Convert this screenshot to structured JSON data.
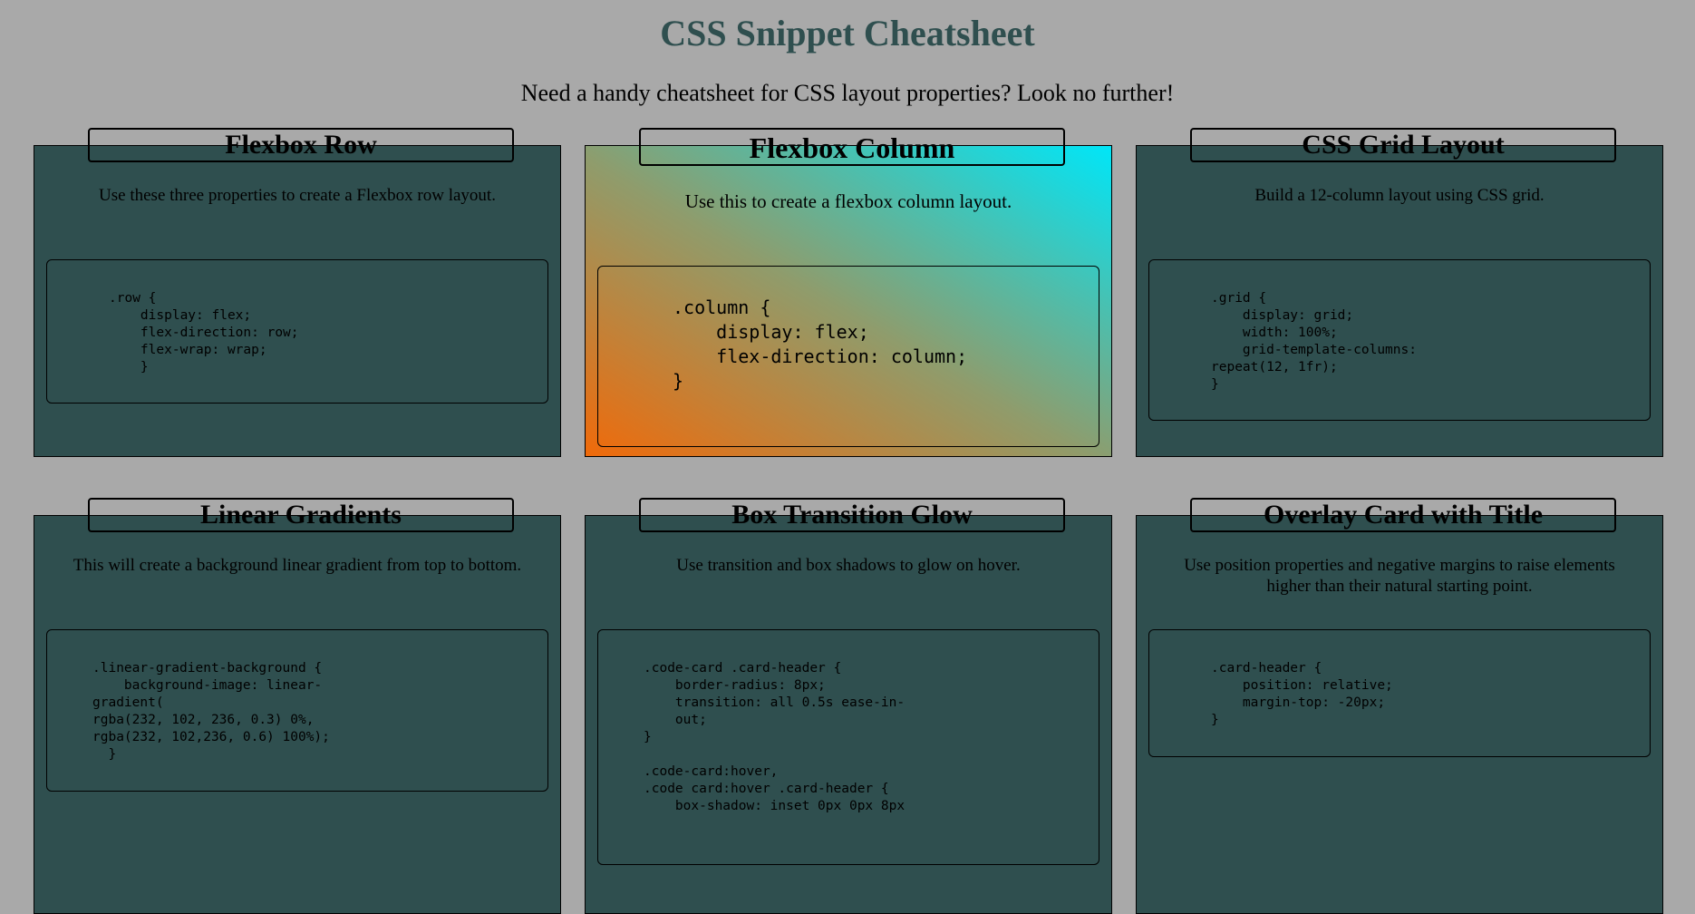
{
  "page": {
    "title": "CSS Snippet Cheatsheet",
    "subtitle": "Need a handy cheatsheet for CSS layout properties? Look no further!"
  },
  "cards": [
    {
      "title": "Flexbox Row",
      "description": "Use these three properties to create a Flexbox row layout.",
      "code": ".row {\n    display: flex;\n    flex-direction: row;\n    flex-wrap: wrap;\n    }"
    },
    {
      "title": "Flexbox Column",
      "description": "Use this to create a flexbox column layout.",
      "code": ".column {\n    display: flex;\n    flex-direction: column;\n}"
    },
    {
      "title": "CSS Grid Layout",
      "description": "Build a 12-column layout using CSS grid.",
      "code": ".grid {\n    display: grid;\n    width: 100%;\n    grid-template-columns:\nrepeat(12, 1fr);\n}"
    },
    {
      "title": "Linear Gradients",
      "description": "This will create a background linear gradient from top to bottom.",
      "code": ".linear-gradient-background {\n    background-image: linear-\ngradient(\nrgba(232, 102, 236, 0.3) 0%,\nrgba(232, 102,236, 0.6) 100%);\n  }"
    },
    {
      "title": "Box Transition Glow",
      "description": "Use transition and box shadows to glow on hover.",
      "code": ".code-card .card-header {\n    border-radius: 8px;\n    transition: all 0.5s ease-in-\n    out;\n}\n\n.code-card:hover,\n.code card:hover .card-header {\n    box-shadow: inset 0px 0px 8px"
    },
    {
      "title": "Overlay Card with Title",
      "description": "Use position properties and negative margins to raise elements higher than their natural starting point.",
      "code": ".card-header {\n    position: relative;\n    margin-top: -20px;\n}"
    }
  ]
}
